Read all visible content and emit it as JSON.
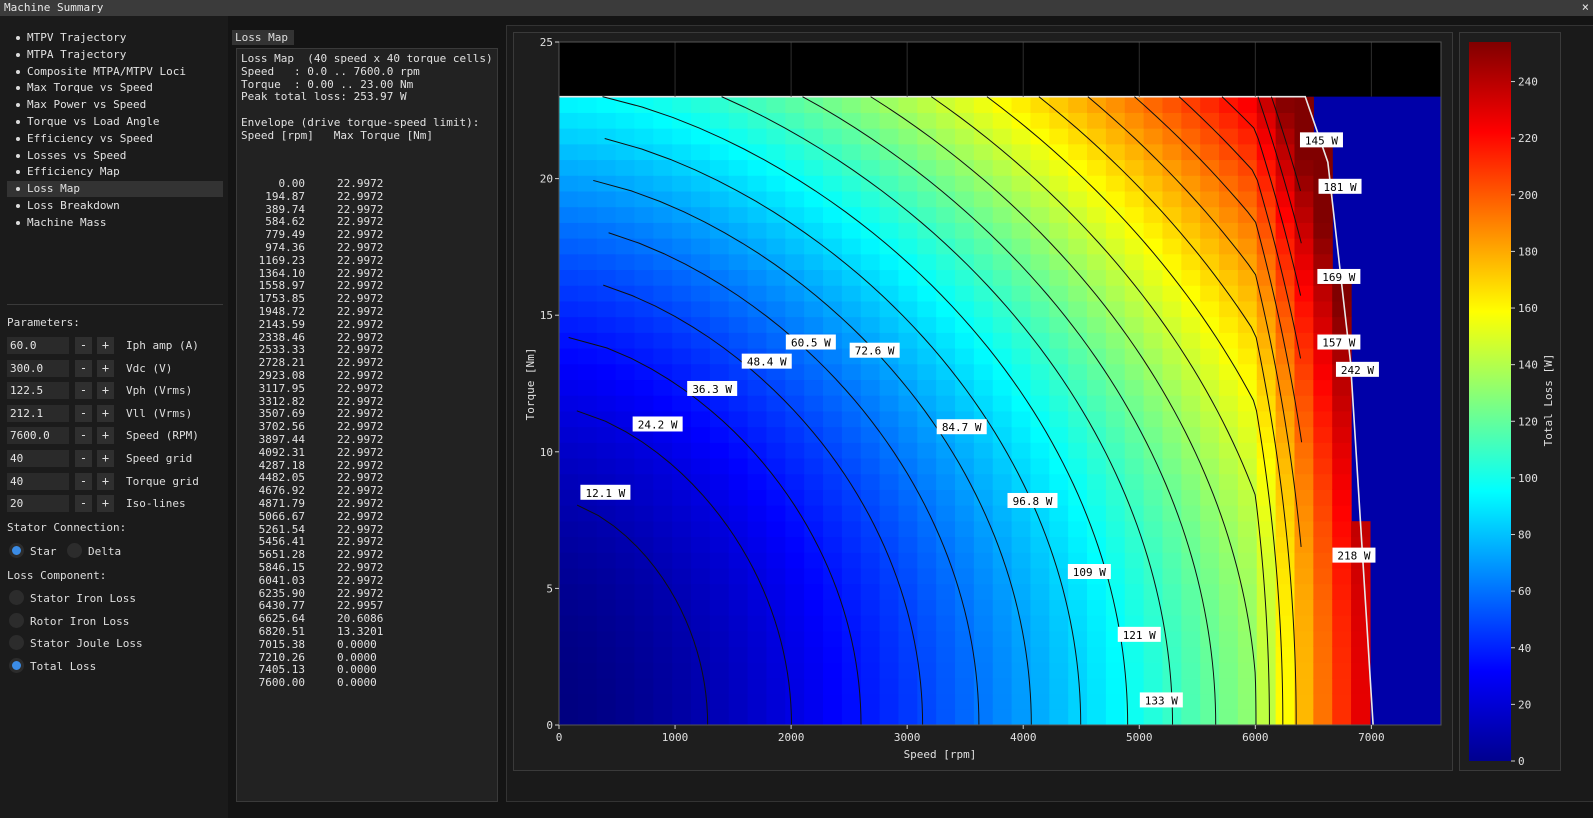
{
  "window": {
    "title": "Machine Summary",
    "close": "×"
  },
  "nav": [
    {
      "label": "MTPV Trajectory",
      "selected": false
    },
    {
      "label": "MTPA Trajectory",
      "selected": false
    },
    {
      "label": "Composite MTPA/MTPV Loci",
      "selected": false
    },
    {
      "label": "Max Torque vs Speed",
      "selected": false
    },
    {
      "label": "Max Power vs Speed",
      "selected": false
    },
    {
      "label": "Torque vs Load Angle",
      "selected": false
    },
    {
      "label": "Efficiency vs Speed",
      "selected": false
    },
    {
      "label": "Losses vs Speed",
      "selected": false
    },
    {
      "label": "Efficiency Map",
      "selected": false
    },
    {
      "label": "Loss Map",
      "selected": true
    },
    {
      "label": "Loss Breakdown",
      "selected": false
    },
    {
      "label": "Machine Mass",
      "selected": false
    }
  ],
  "parameters": {
    "heading": "Parameters:",
    "minus": "-",
    "plus": "+",
    "rows": [
      {
        "value": "60.0",
        "name": "Iph amp (A)"
      },
      {
        "value": "300.0",
        "name": "Vdc (V)"
      },
      {
        "value": "122.5",
        "name": "Vph (Vrms)"
      },
      {
        "value": "212.1",
        "name": "Vll (Vrms)"
      },
      {
        "value": "7600.0",
        "name": "Speed (RPM)"
      },
      {
        "value": "40",
        "name": "Speed grid"
      },
      {
        "value": "40",
        "name": "Torque grid"
      },
      {
        "value": "20",
        "name": "Iso-lines"
      }
    ]
  },
  "stator_connection": {
    "heading": "Stator Connection:",
    "options": [
      {
        "label": "Star",
        "selected": true
      },
      {
        "label": "Delta",
        "selected": false
      }
    ]
  },
  "loss_component": {
    "heading": "Loss Component:",
    "options": [
      {
        "label": "Stator Iron Loss",
        "selected": false
      },
      {
        "label": "Rotor Iron Loss",
        "selected": false
      },
      {
        "label": "Stator Joule Loss",
        "selected": false
      },
      {
        "label": "Total Loss",
        "selected": true
      }
    ]
  },
  "loss_map_panel": {
    "tab": "Loss Map",
    "header_lines": [
      "Loss Map  (40 speed x 40 torque cells)",
      "Speed   : 0.0 .. 7600.0 rpm",
      "Torque  : 0.00 .. 23.00 Nm",
      "Peak total loss: 253.97 W",
      "",
      "Envelope (drive torque-speed limit):",
      "Speed [rpm]   Max Torque [Nm]"
    ],
    "envelope": [
      [
        "0.00",
        "22.9972"
      ],
      [
        "194.87",
        "22.9972"
      ],
      [
        "389.74",
        "22.9972"
      ],
      [
        "584.62",
        "22.9972"
      ],
      [
        "779.49",
        "22.9972"
      ],
      [
        "974.36",
        "22.9972"
      ],
      [
        "1169.23",
        "22.9972"
      ],
      [
        "1364.10",
        "22.9972"
      ],
      [
        "1558.97",
        "22.9972"
      ],
      [
        "1753.85",
        "22.9972"
      ],
      [
        "1948.72",
        "22.9972"
      ],
      [
        "2143.59",
        "22.9972"
      ],
      [
        "2338.46",
        "22.9972"
      ],
      [
        "2533.33",
        "22.9972"
      ],
      [
        "2728.21",
        "22.9972"
      ],
      [
        "2923.08",
        "22.9972"
      ],
      [
        "3117.95",
        "22.9972"
      ],
      [
        "3312.82",
        "22.9972"
      ],
      [
        "3507.69",
        "22.9972"
      ],
      [
        "3702.56",
        "22.9972"
      ],
      [
        "3897.44",
        "22.9972"
      ],
      [
        "4092.31",
        "22.9972"
      ],
      [
        "4287.18",
        "22.9972"
      ],
      [
        "4482.05",
        "22.9972"
      ],
      [
        "4676.92",
        "22.9972"
      ],
      [
        "4871.79",
        "22.9972"
      ],
      [
        "5066.67",
        "22.9972"
      ],
      [
        "5261.54",
        "22.9972"
      ],
      [
        "5456.41",
        "22.9972"
      ],
      [
        "5651.28",
        "22.9972"
      ],
      [
        "5846.15",
        "22.9972"
      ],
      [
        "6041.03",
        "22.9972"
      ],
      [
        "6235.90",
        "22.9972"
      ],
      [
        "6430.77",
        "22.9957"
      ],
      [
        "6625.64",
        "20.6086"
      ],
      [
        "6820.51",
        "13.3201"
      ],
      [
        "7015.38",
        "0.0000"
      ],
      [
        "7210.26",
        "0.0000"
      ],
      [
        "7405.13",
        "0.0000"
      ],
      [
        "7600.00",
        "0.0000"
      ]
    ]
  },
  "chart_data": {
    "type": "heatmap",
    "title": "",
    "xlabel": "Speed [rpm]",
    "ylabel": "Torque [Nm]",
    "xlim": [
      0,
      7600
    ],
    "ylim": [
      0,
      25
    ],
    "xticks": [
      0,
      1000,
      2000,
      3000,
      4000,
      5000,
      6000,
      7000
    ],
    "yticks": [
      0,
      5,
      10,
      15,
      20,
      25
    ],
    "grid": true,
    "colormap": "jet",
    "colorbar": {
      "label": "Total Loss [W]",
      "range": [
        0,
        253.97
      ],
      "ticks": [
        0,
        20,
        40,
        60,
        80,
        100,
        120,
        140,
        160,
        180,
        200,
        220,
        240
      ]
    },
    "contour_labels": [
      {
        "label": "12.1 W",
        "speed": 400,
        "torque": 8.5
      },
      {
        "label": "24.2 W",
        "speed": 850,
        "torque": 11.0
      },
      {
        "label": "36.3 W",
        "speed": 1320,
        "torque": 12.3
      },
      {
        "label": "48.4 W",
        "speed": 1790,
        "torque": 13.3
      },
      {
        "label": "60.5 W",
        "speed": 2170,
        "torque": 14.0
      },
      {
        "label": "72.6 W",
        "speed": 2720,
        "torque": 13.7
      },
      {
        "label": "84.7 W",
        "speed": 3470,
        "torque": 10.9
      },
      {
        "label": "96.8 W",
        "speed": 4080,
        "torque": 8.2
      },
      {
        "label": "109 W",
        "speed": 4570,
        "torque": 5.6
      },
      {
        "label": "121 W",
        "speed": 5000,
        "torque": 3.3
      },
      {
        "label": "133 W",
        "speed": 5190,
        "torque": 0.9
      },
      {
        "label": "145 W",
        "speed": 6570,
        "torque": 21.4
      },
      {
        "label": "181 W",
        "speed": 6730,
        "torque": 19.7
      },
      {
        "label": "169 W",
        "speed": 6720,
        "torque": 16.4
      },
      {
        "label": "157 W",
        "speed": 6720,
        "torque": 14.0
      },
      {
        "label": "242 W",
        "speed": 6880,
        "torque": 13.0
      },
      {
        "label": "218 W",
        "speed": 6850,
        "torque": 6.2
      }
    ],
    "envelope_max_torque": 23.0,
    "peak_loss": 253.97
  },
  "colors": {
    "accent": "#3b8ce6",
    "plot_bg": "#000000",
    "envelope_outside": "#0000a8"
  }
}
